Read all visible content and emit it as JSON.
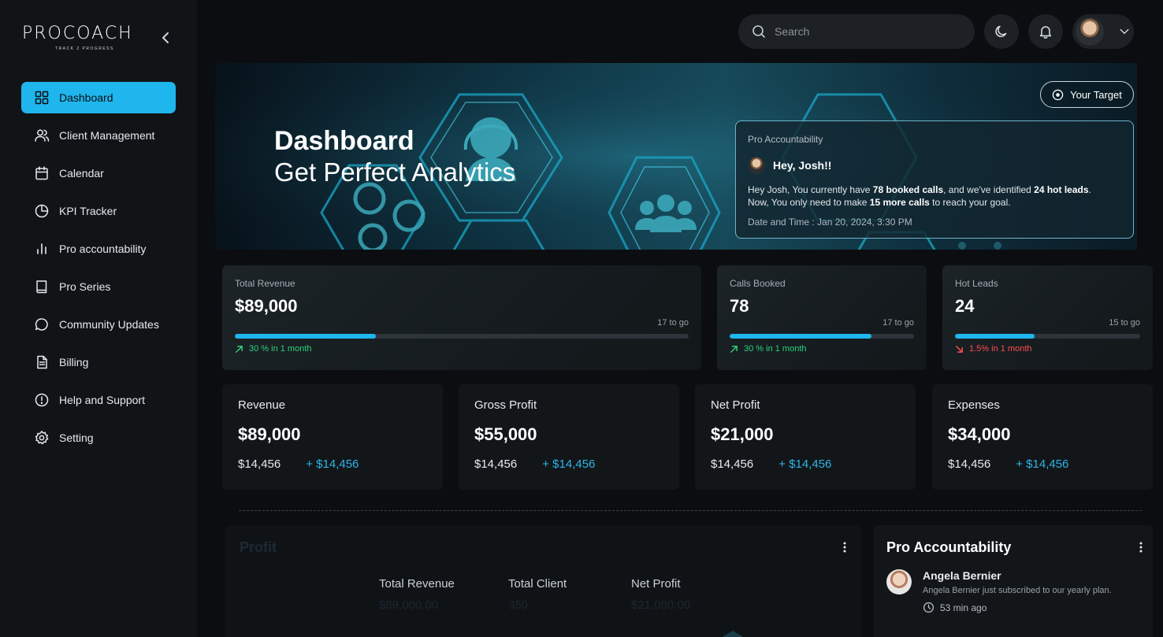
{
  "brand": {
    "name": "PROCOACH",
    "tagline": "TRACK 2 PROGRESS"
  },
  "sidebar": {
    "items": [
      {
        "label": "Dashboard",
        "icon": "grid-icon",
        "active": true
      },
      {
        "label": "Client Management",
        "icon": "users-icon"
      },
      {
        "label": "Calendar",
        "icon": "calendar-icon"
      },
      {
        "label": "KPI Tracker",
        "icon": "pie-chart-icon"
      },
      {
        "label": "Pro accountability",
        "icon": "bar-chart-icon"
      },
      {
        "label": "Pro Series",
        "icon": "book-icon"
      },
      {
        "label": "Community Updates",
        "icon": "message-icon"
      },
      {
        "label": "Billing",
        "icon": "document-icon"
      },
      {
        "label": "Help and Support",
        "icon": "alert-circle-icon"
      },
      {
        "label": "Setting",
        "icon": "gear-icon"
      }
    ]
  },
  "topbar": {
    "search_placeholder": "Search"
  },
  "hero": {
    "title": "Dashboard",
    "subtitle": "Get Perfect Analytics",
    "target_button": "Your Target",
    "card": {
      "label": "Pro Accountability",
      "greeting": "Hey, Josh!!",
      "text_1": "Hey Josh, You currently have ",
      "calls": "78 booked calls",
      "text_2": ", and we've identified ",
      "leads": "24 hot leads",
      "text_3": ".",
      "text_4": "Now, You only need to make ",
      "more_calls": "15 more calls",
      "text_5": " to reach your goal.",
      "date": "Date and Time : Jan 20, 2024, 3:30 PM"
    }
  },
  "kpis": [
    {
      "label": "Total Revenue",
      "value": "$89,000",
      "togo": "17 to go",
      "progress": 0.31,
      "trend": "30 % in 1 month",
      "direction": "up"
    },
    {
      "label": "Calls Booked",
      "value": "78",
      "togo": "17 to go",
      "progress": 0.77,
      "trend": "30 % in 1 month",
      "direction": "up"
    },
    {
      "label": "Hot Leads",
      "value": "24",
      "togo": "15 to go",
      "progress": 0.43,
      "trend": "1.5% in 1 month",
      "direction": "down"
    }
  ],
  "finance": [
    {
      "label": "Revenue",
      "value": "$89,000",
      "base": "$14,456",
      "delta": "+ $14,456"
    },
    {
      "label": "Gross Profit",
      "value": "$55,000",
      "base": "$14,456",
      "delta": "+ $14,456"
    },
    {
      "label": "Net Profit",
      "value": "$21,000",
      "base": "$14,456",
      "delta": "+ $14,456"
    },
    {
      "label": "Expenses",
      "value": "$34,000",
      "base": "$14,456",
      "delta": "+ $14,456"
    }
  ],
  "profit": {
    "title": "Profit",
    "stats": [
      {
        "label": "Total Revenue",
        "value": "$89,000.00"
      },
      {
        "label": "Total Client",
        "value": "350"
      },
      {
        "label": "Net Profit",
        "value": "$21,000.00"
      }
    ]
  },
  "pro_accountability": {
    "title": "Pro Accountability",
    "items": [
      {
        "name": "Angela Bernier",
        "message": "Angela Bernier just subscribed to our yearly plan.",
        "time": "53 min ago"
      }
    ]
  },
  "colors": {
    "accent": "#1fb6ee",
    "up": "#2bd37a",
    "down": "#ff4d4d",
    "background": "#0b0d10"
  }
}
